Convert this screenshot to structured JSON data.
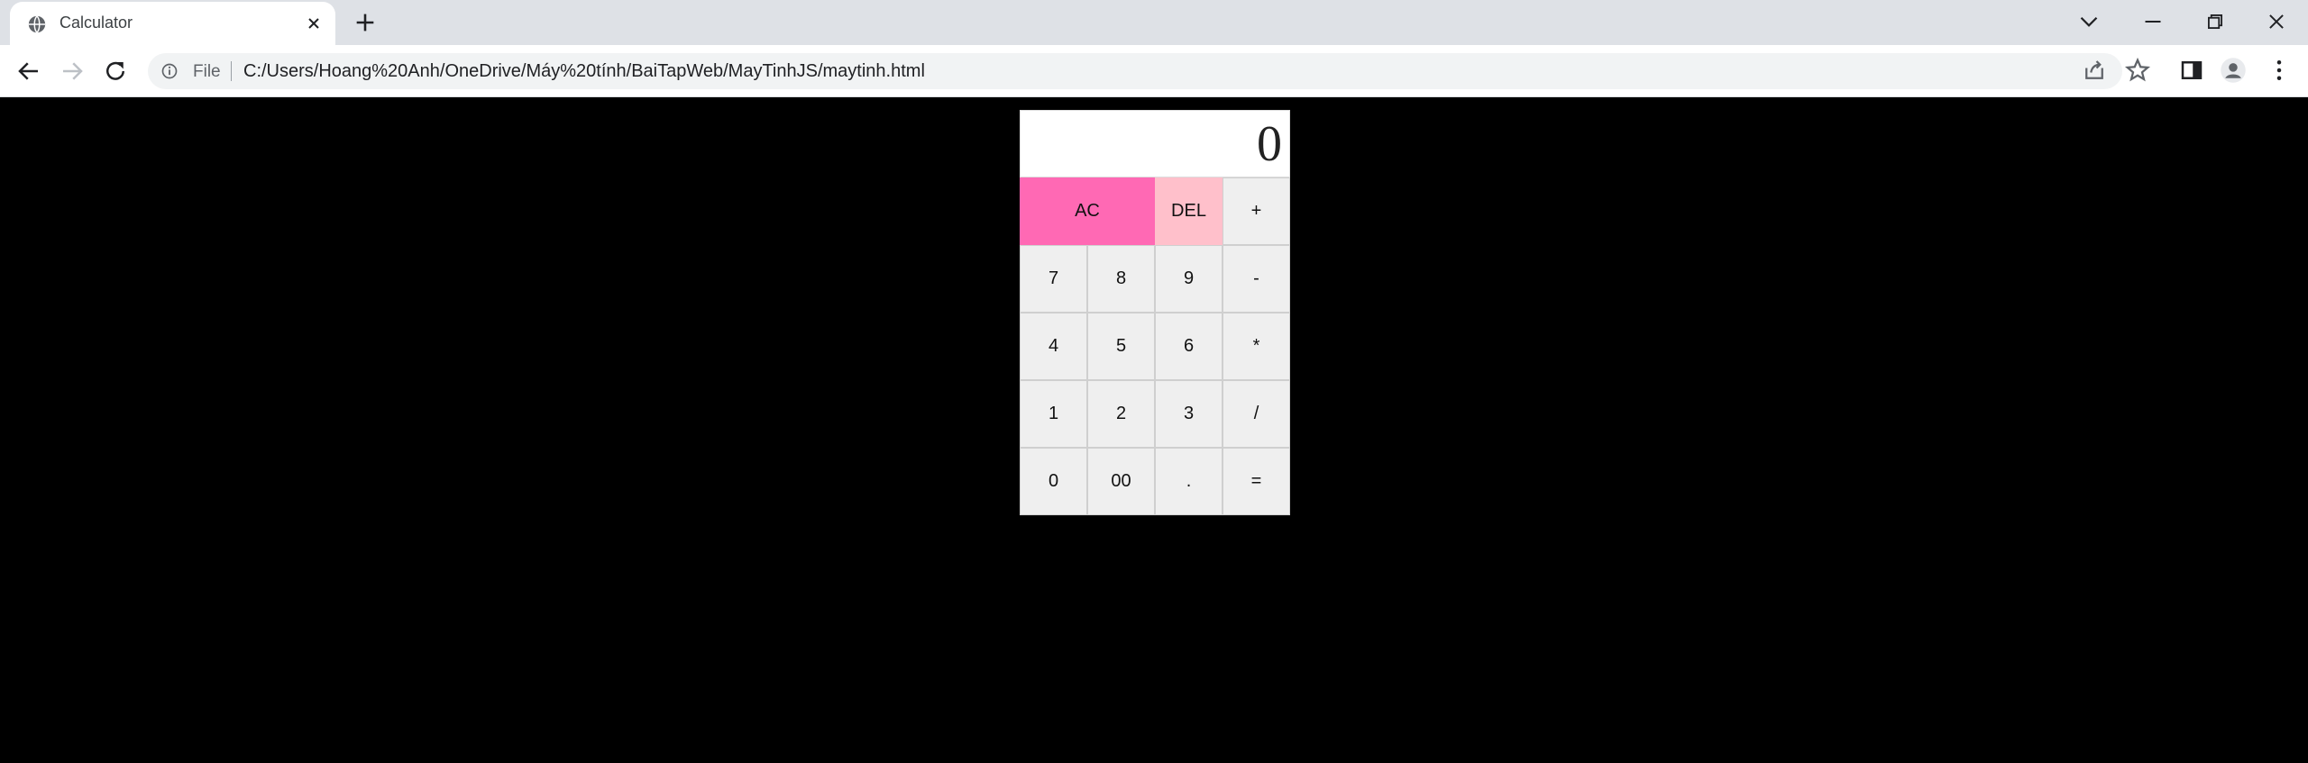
{
  "browser": {
    "tab_title": "Calculator",
    "file_label": "File",
    "url": "C:/Users/Hoang%20Anh/OneDrive/Máy%20tính/BaiTapWeb/MayTinhJS/maytinh.html"
  },
  "calculator": {
    "display": "0",
    "keys": [
      {
        "label": "AC",
        "name": "all-clear-button",
        "color": "#ff69b4",
        "span": 2
      },
      {
        "label": "DEL",
        "name": "delete-button",
        "color": "#ffc0cb",
        "span": 1
      },
      {
        "label": "+",
        "name": "plus-button",
        "span": 1
      },
      {
        "label": "7",
        "name": "digit-7-button",
        "span": 1
      },
      {
        "label": "8",
        "name": "digit-8-button",
        "span": 1
      },
      {
        "label": "9",
        "name": "digit-9-button",
        "span": 1
      },
      {
        "label": "-",
        "name": "minus-button",
        "span": 1
      },
      {
        "label": "4",
        "name": "digit-4-button",
        "span": 1
      },
      {
        "label": "5",
        "name": "digit-5-button",
        "span": 1
      },
      {
        "label": "6",
        "name": "digit-6-button",
        "span": 1
      },
      {
        "label": "*",
        "name": "multiply-button",
        "span": 1
      },
      {
        "label": "1",
        "name": "digit-1-button",
        "span": 1
      },
      {
        "label": "2",
        "name": "digit-2-button",
        "span": 1
      },
      {
        "label": "3",
        "name": "digit-3-button",
        "span": 1
      },
      {
        "label": "/",
        "name": "divide-button",
        "span": 1
      },
      {
        "label": "0",
        "name": "digit-0-button",
        "span": 1
      },
      {
        "label": "00",
        "name": "double-zero-button",
        "span": 1
      },
      {
        "label": ".",
        "name": "decimal-point-button",
        "span": 1
      },
      {
        "label": "=",
        "name": "equals-button",
        "span": 1
      }
    ]
  },
  "colors": {
    "page_background": "#000000",
    "ac_key": "#ff69b4",
    "del_key": "#ffc0cb"
  }
}
